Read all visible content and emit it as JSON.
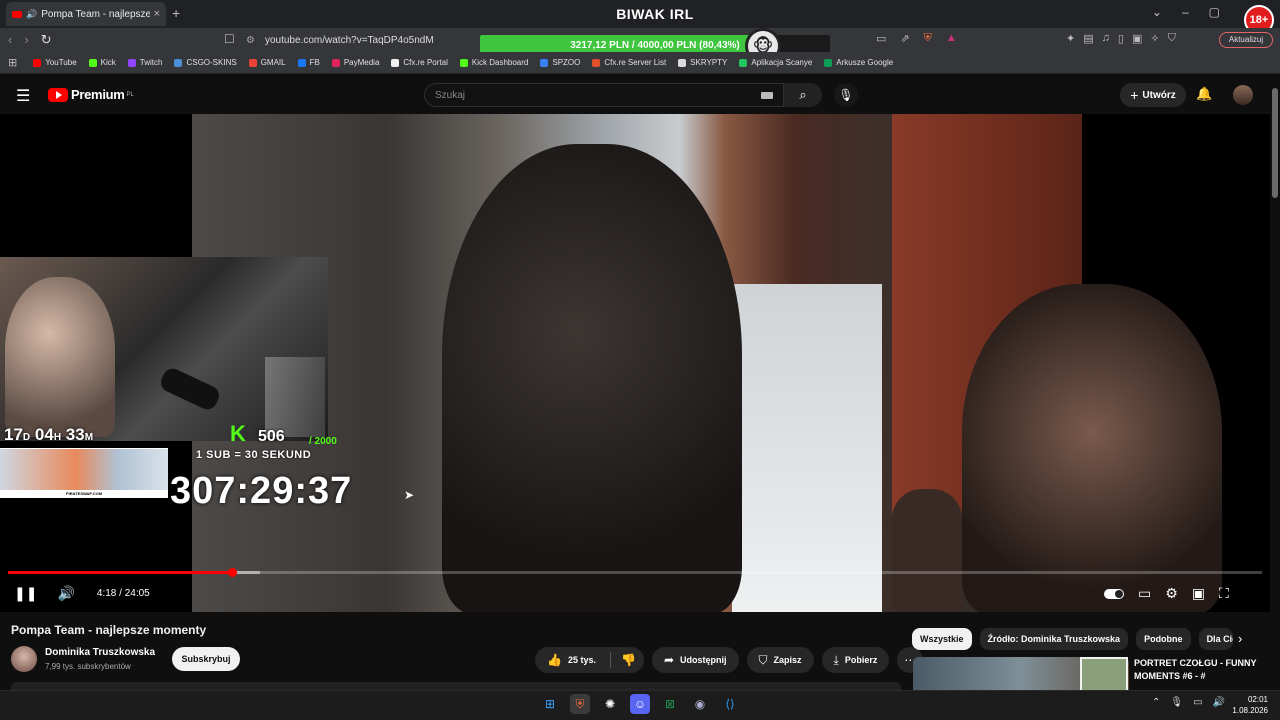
{
  "browser": {
    "tab_title": "Pompa Team - najlepsze mom",
    "window_title": "BIWAK IRL",
    "url": "youtube.com/watch?v=TaqDP4o5ndM",
    "age_badge": "18+",
    "update_button": "Aktualizuj",
    "donation_text": "3217,12 PLN / 4000,00 PLN  (80,43%)",
    "donation_progress": 0.8043,
    "bookmarks": [
      {
        "label": "YouTube",
        "color": "#ff0000"
      },
      {
        "label": "Kick",
        "color": "#53fc18"
      },
      {
        "label": "Twitch",
        "color": "#9146ff"
      },
      {
        "label": "CSGO-SKINS",
        "color": "#4a90d9"
      },
      {
        "label": "GMAIL",
        "color": "#ea4335"
      },
      {
        "label": "FB",
        "color": "#1877f2"
      },
      {
        "label": "PayMedia",
        "color": "#e0245e"
      },
      {
        "label": "Cfx.re Portal",
        "color": "#f0f0f0"
      },
      {
        "label": "Kick Dashboard",
        "color": "#53fc18"
      },
      {
        "label": "SPZOO",
        "color": "#3b82f6"
      },
      {
        "label": "Cfx.re Server List",
        "color": "#e04e2a"
      },
      {
        "label": "SKRYPTY",
        "color": "#dddddd"
      },
      {
        "label": "Aplikacja Scanye",
        "color": "#22c55e"
      },
      {
        "label": "Arkusze Google",
        "color": "#0f9d58"
      }
    ]
  },
  "youtube": {
    "logo_text": "Premium",
    "region": "PL",
    "search_placeholder": "Szukaj",
    "create_label": "Utwórz",
    "accent": "#ff0000"
  },
  "overlay": {
    "days": "17",
    "hours": "04",
    "minutes": "33",
    "day_unit": "D",
    "hour_unit": "H",
    "minute_unit": "M",
    "subs": "506",
    "subs_goal": "/ 2000",
    "rule": "1 SUB = 30 SEKUND",
    "ad_text": "PIRATESWAP.COM",
    "timer": "307:29:37"
  },
  "player": {
    "current_time": "4:18",
    "duration": "24:05",
    "time_display": "4:18 / 24:05",
    "played_fraction": 0.179,
    "buffered_fraction": 0.201
  },
  "video": {
    "title": "Pompa Team - najlepsze momenty",
    "channel": "Dominika Truszkowska",
    "subscribers": "7,99 tys. subskrybentów",
    "subscribe_label": "Subskrybuj",
    "likes": "25 tys.",
    "share_label": "Udostępnij",
    "save_label": "Zapisz",
    "download_label": "Pobierz"
  },
  "recommendations": {
    "chips": [
      "Wszystkie",
      "Źródło: Dominika Truszkowska",
      "Podobne",
      "Dla Cie"
    ],
    "first_title": "PORTRET CZOŁGU - FUNNY MOMENTS #6 - #"
  },
  "taskbar": {
    "time": "02:01",
    "date": "1.08.2026"
  }
}
